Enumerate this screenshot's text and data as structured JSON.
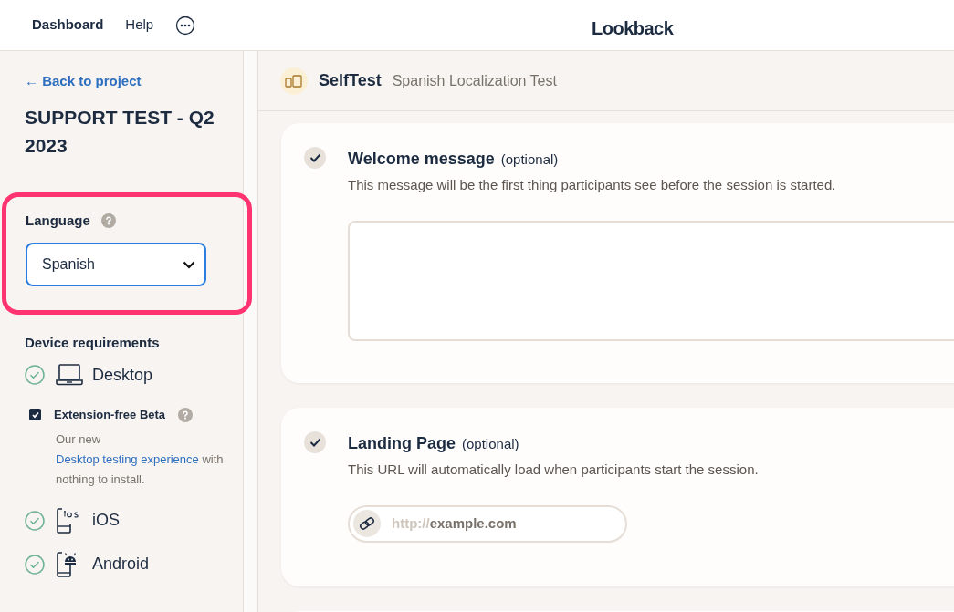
{
  "nav": {
    "items": [
      {
        "label": "Dashboard",
        "selected": true
      },
      {
        "label": "Help",
        "selected": false
      }
    ],
    "title": "Lookback"
  },
  "sidebar": {
    "back_link": "← Back to project",
    "project_title": "SUPPORT TEST - Q2 2023",
    "language": {
      "label": "Language",
      "value": "Spanish",
      "highlighted": true
    },
    "device_requirements": {
      "heading": "Device requirements",
      "devices": [
        {
          "kind": "desktop",
          "label": "Desktop",
          "checked": true,
          "option": {
            "label": "Extension-free Beta",
            "checked": true,
            "description": [
              {
                "text": "Our new ",
                "link": false
              },
              {
                "text": "Desktop testing experience",
                "link": true
              },
              {
                "text": " with nothing to install.",
                "link": false
              }
            ]
          }
        },
        {
          "kind": "ios",
          "label": "iOS",
          "checked": true
        },
        {
          "kind": "android",
          "label": "Android",
          "checked": true
        }
      ]
    }
  },
  "header": {
    "name": "SelfTest",
    "subtitle": "Spanish Localization Test"
  },
  "sections": [
    {
      "kind": "textarea",
      "title": "Welcome message",
      "tag": "(optional)",
      "description": "This message will be the first thing participants see before the session is started.",
      "done": true
    },
    {
      "kind": "url",
      "title": "Landing Page",
      "tag": "(optional)",
      "description": "This URL will automatically load when participants start the session.",
      "done": true,
      "prefix": "http://",
      "placeholder": "example.com"
    }
  ]
}
